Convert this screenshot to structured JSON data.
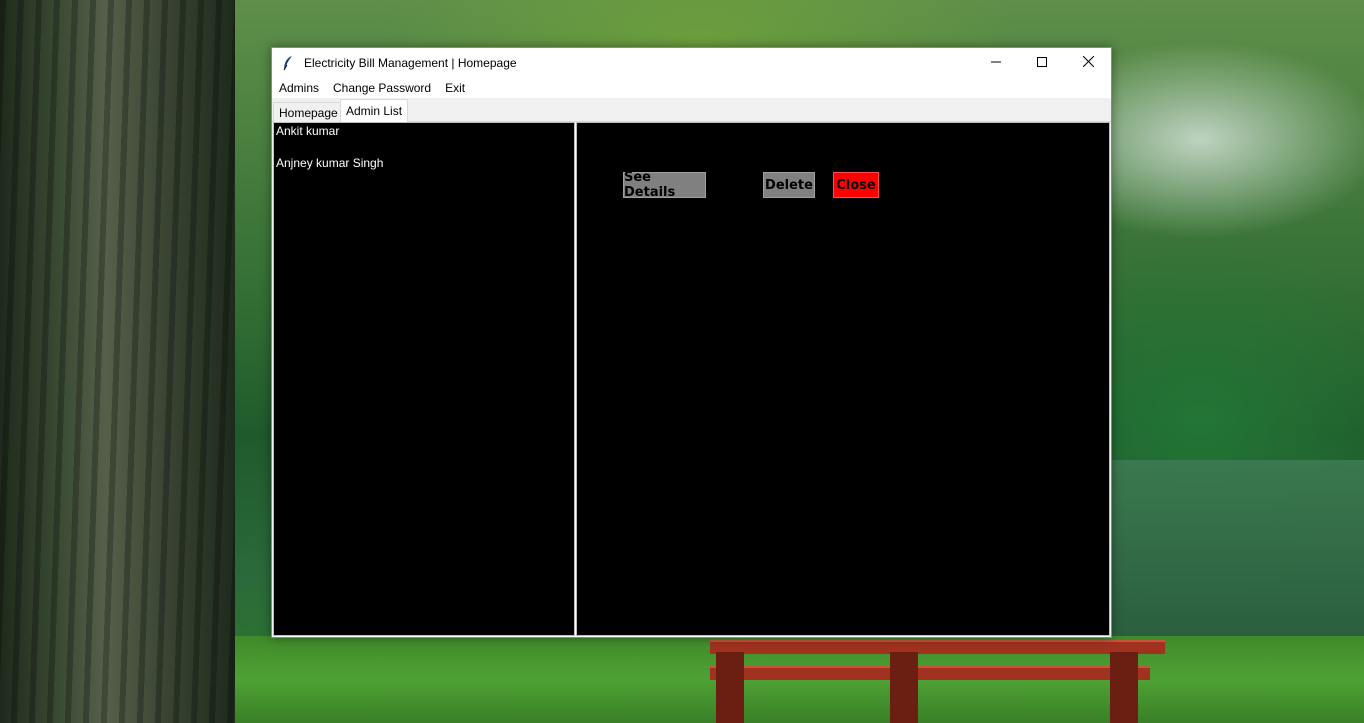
{
  "window": {
    "title": "Electricity Bill Management | Homepage",
    "icon": "feather-icon",
    "controls": [
      "minimize-icon",
      "maximize-icon",
      "close-icon"
    ]
  },
  "menu": {
    "items": [
      "Admins",
      "Change Password",
      "Exit"
    ]
  },
  "tabs": {
    "items": [
      "Homepage",
      "Admin List"
    ],
    "selected": "Admin List"
  },
  "admin_list": {
    "items": [
      "Ankit kumar",
      "Anjney kumar Singh"
    ]
  },
  "actions": {
    "see_details": "See Details",
    "delete": "Delete",
    "close": "Close"
  },
  "colors": {
    "pane_background": "#000000",
    "button_gray": "#808080",
    "button_close": "#ff0000"
  }
}
